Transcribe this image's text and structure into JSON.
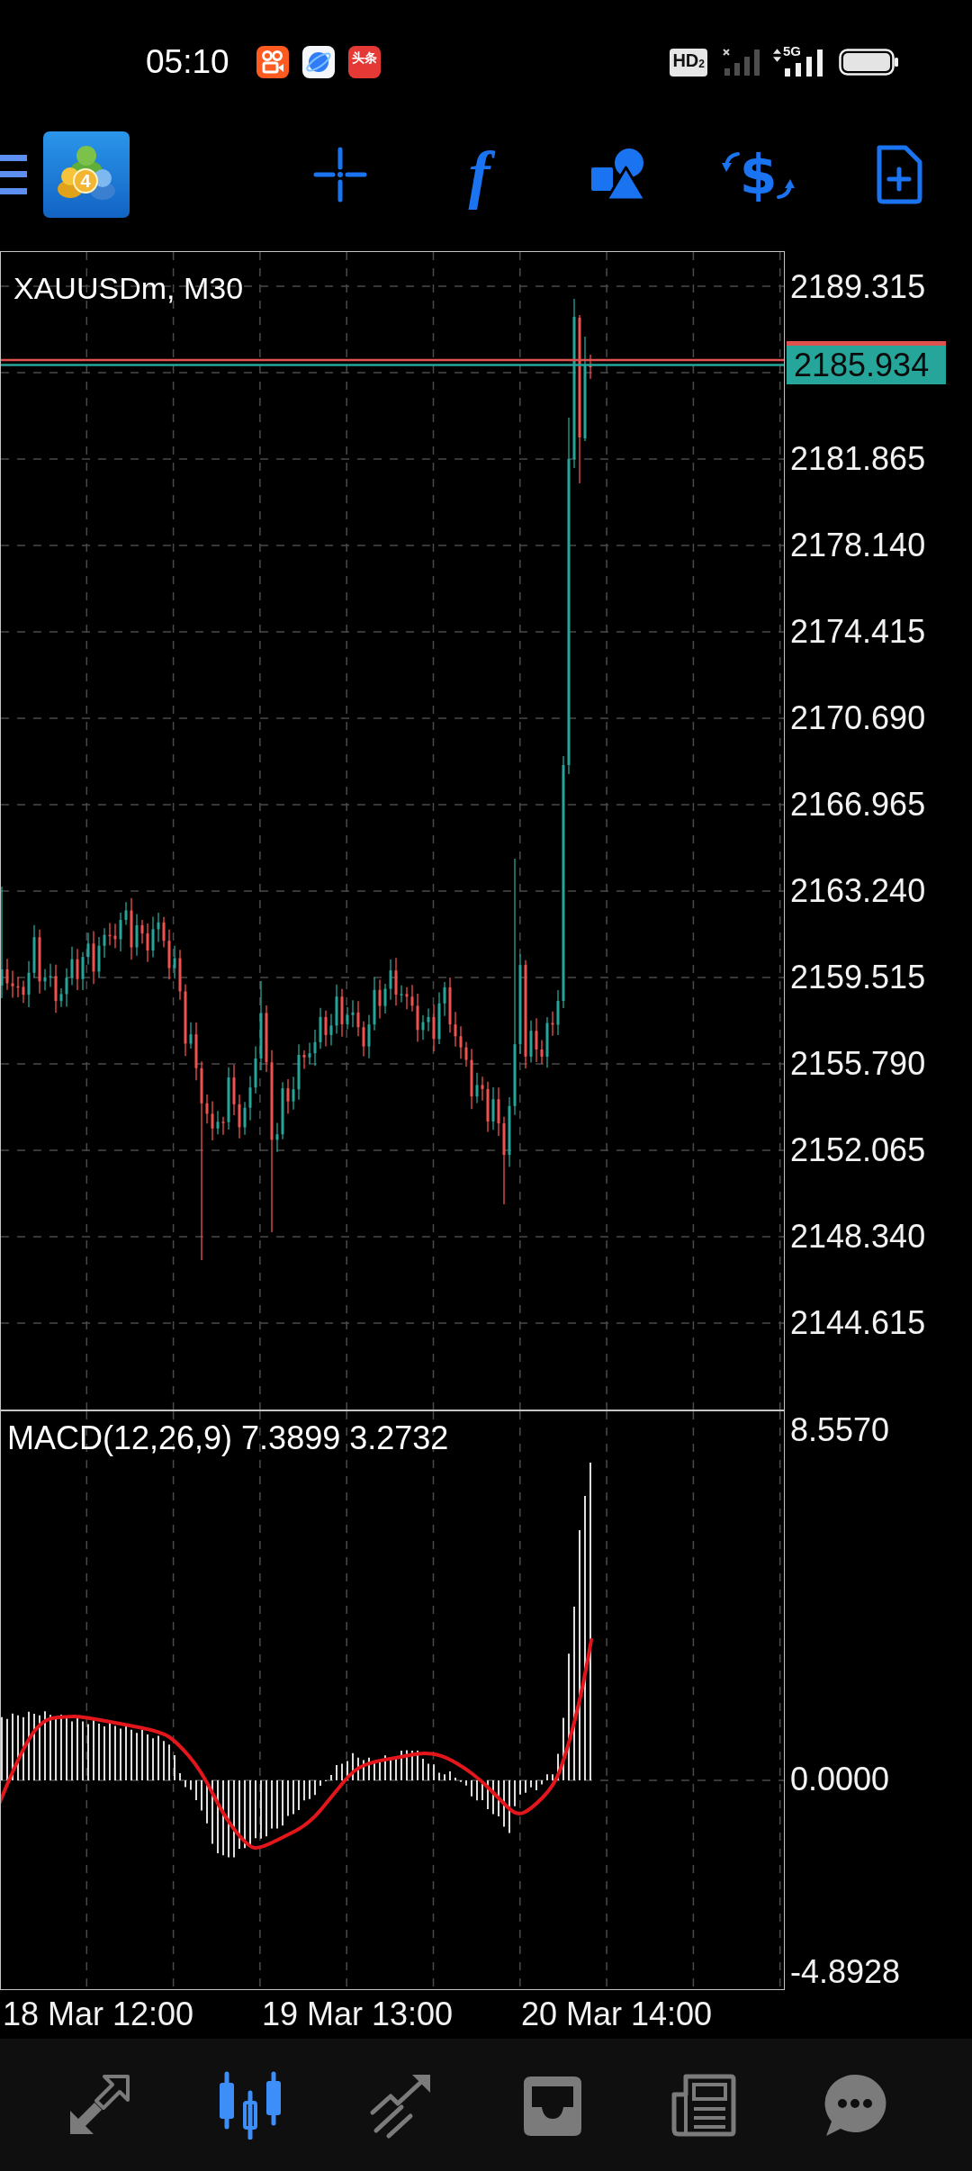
{
  "status_bar": {
    "time": "05:10",
    "notification_icons": [
      {
        "kind": "video"
      },
      {
        "kind": "browser"
      },
      {
        "kind": "news",
        "text": "头条"
      }
    ],
    "hd_badge": "HD$_{2}$",
    "network": "5G"
  },
  "toolbar": {
    "buttons": [
      {
        "kind": "menu"
      },
      {
        "kind": "logo",
        "text": "4"
      },
      {
        "kind": "crosshair"
      },
      {
        "kind": "function",
        "text": "f"
      },
      {
        "kind": "shapes"
      },
      {
        "kind": "currency",
        "text": "$"
      },
      {
        "kind": "new_document"
      }
    ]
  },
  "price_chart": {
    "title": "XAUUSDm, M30",
    "price_axis": [
      "2189.315",
      "2181.865",
      "2178.140",
      "2174.415",
      "2170.690",
      "2166.965",
      "2163.240",
      "2159.515",
      "2155.790",
      "2152.065",
      "2148.340",
      "2144.615"
    ],
    "current_price": "2185.934"
  },
  "macd": {
    "label": "MACD(12,26,9) 7.3899 3.2732",
    "axis": [
      "8.5570",
      "0.0000",
      "-4.8928"
    ]
  },
  "time_axis": [
    "18 Mar 12:00",
    "19 Mar 13:00",
    "20 Mar 14:00"
  ],
  "bottom_nav": [
    {
      "kind": "arrows",
      "selected": false
    },
    {
      "kind": "candles",
      "selected": true
    },
    {
      "kind": "trend",
      "selected": false
    },
    {
      "kind": "tray",
      "selected": false
    },
    {
      "kind": "newspaper",
      "selected": false
    },
    {
      "kind": "chat",
      "selected": false
    }
  ]
}
